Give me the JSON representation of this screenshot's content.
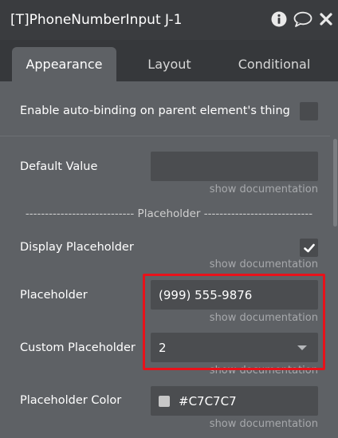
{
  "window": {
    "title": "[T]PhoneNumberInput J-1",
    "icons": [
      "info-icon",
      "comment-icon",
      "close-icon"
    ]
  },
  "tabs": [
    {
      "label": "Appearance",
      "active": true
    },
    {
      "label": "Layout",
      "active": false
    },
    {
      "label": "Conditional",
      "active": false
    }
  ],
  "auto_binding": {
    "label": "Enable auto-binding on parent element's thing",
    "checked": false
  },
  "default_value": {
    "label": "Default Value",
    "value": "",
    "doc_link": "show documentation"
  },
  "placeholder_section": {
    "separator": "---------------------------- Placeholder ----------------------------"
  },
  "display_placeholder": {
    "label": "Display Placeholder",
    "checked": true,
    "doc_link": "show documentation"
  },
  "placeholder": {
    "label": "Placeholder",
    "value": "(999) 555-9876",
    "doc_link": "show documentation"
  },
  "custom_placeholder": {
    "label": "Custom Placeholder",
    "value": "2",
    "doc_link": "show documentation"
  },
  "placeholder_color": {
    "label": "Placeholder Color",
    "value": "#C7C7C7",
    "swatch_color": "#C7C7C7",
    "doc_link": "show documentation"
  },
  "colors": {
    "highlight": "#e8121a",
    "panel": "#5e6165",
    "field": "#4b4d50"
  }
}
